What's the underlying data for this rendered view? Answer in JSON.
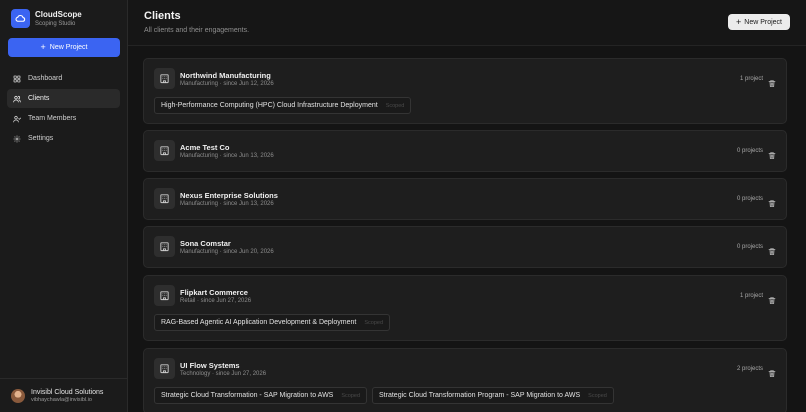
{
  "brand": {
    "name": "CloudScope",
    "subtitle": "Scoping Studio"
  },
  "sidebar": {
    "new_project_label": "New Project",
    "nav": [
      {
        "label": "Dashboard",
        "icon": "dashboard-icon"
      },
      {
        "label": "Clients",
        "icon": "clients-icon"
      },
      {
        "label": "Team Members",
        "icon": "team-icon"
      },
      {
        "label": "Settings",
        "icon": "gear-icon"
      }
    ],
    "active_item": "Clients"
  },
  "user": {
    "name": "Invisibl Cloud Solutions",
    "email": "vibhaychawla@invisibl.io"
  },
  "header": {
    "title": "Clients",
    "subtitle": "All clients and their engagements.",
    "new_project_label": "New Project"
  },
  "clients": [
    {
      "name": "Northwind Manufacturing",
      "meta": "Manufacturing · since Jun 12, 2026",
      "count": "1 project",
      "projects": [
        {
          "title": "High-Performance Computing (HPC) Cloud Infrastructure Deployment",
          "status": "Scoped"
        }
      ]
    },
    {
      "name": "Acme Test Co",
      "meta": "Manufacturing · since Jun 13, 2026",
      "count": "0 projects",
      "projects": []
    },
    {
      "name": "Nexus Enterprise Solutions",
      "meta": "Manufacturing · since Jun 13, 2026",
      "count": "0 projects",
      "projects": []
    },
    {
      "name": "Sona Comstar",
      "meta": "Manufacturing · since Jun 20, 2026",
      "count": "0 projects",
      "projects": []
    },
    {
      "name": "Flipkart Commerce",
      "meta": "Retail · since Jun 27, 2026",
      "count": "1 project",
      "projects": [
        {
          "title": "RAG-Based Agentic AI Application Development & Deployment",
          "status": "Scoped"
        }
      ]
    },
    {
      "name": "UI Flow Systems",
      "meta": "Technology · since Jun 27, 2026",
      "count": "2 projects",
      "projects": [
        {
          "title": "Strategic Cloud Transformation - SAP Migration to AWS",
          "status": "Scoped"
        },
        {
          "title": "Strategic Cloud Transformation Program - SAP Migration to AWS",
          "status": "Scoped"
        }
      ]
    }
  ],
  "colors": {
    "accent": "#3b64f2",
    "background": "#141414",
    "card": "#1e1e1e"
  }
}
